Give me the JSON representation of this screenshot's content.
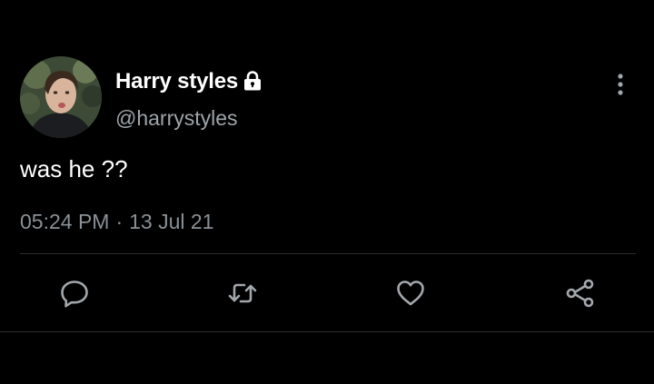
{
  "tweet": {
    "author": {
      "display_name": "Harry styles",
      "handle": "@harrystyles",
      "protected_icon": "lock-icon"
    },
    "text": "was he ??",
    "time": "05:24 PM",
    "separator": "·",
    "date": "13 Jul 21"
  },
  "actions": {
    "reply_icon": "reply-icon",
    "retweet_icon": "retweet-icon",
    "like_icon": "heart-icon",
    "share_icon": "share-icon"
  },
  "colors": {
    "background": "#000000",
    "primary_text": "#ffffff",
    "secondary_text": "#9ea4a9",
    "icon": "#a2a7ac",
    "divider": "#2a2d30"
  }
}
